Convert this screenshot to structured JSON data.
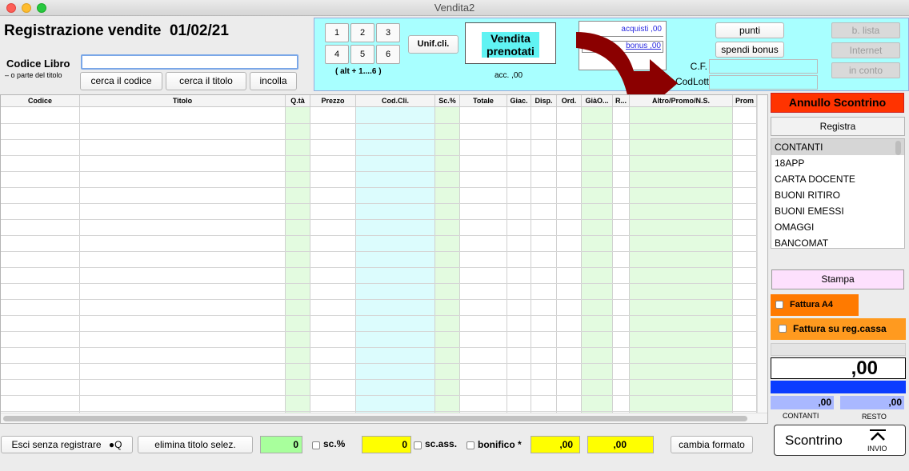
{
  "window": {
    "title": "Vendita2"
  },
  "header": {
    "title": "Registrazione vendite",
    "date": "01/02/21",
    "codice_libro_label": "Codice Libro",
    "codice_libro_hint": "– o parte del  titolo",
    "codice_libro_value": "",
    "buttons": {
      "cerca_codice": "cerca il codice",
      "cerca_titolo": "cerca il titolo",
      "incolla": "incolla"
    }
  },
  "cyan_panel": {
    "num_buttons": [
      "1",
      "2",
      "3",
      "4",
      "5",
      "6"
    ],
    "alt_hint": "( alt + 1....6 )",
    "unif_cli": "Unif.cli.",
    "vendita_prenotati": "Vendita prenotati",
    "acc": "acc. ,00",
    "acquisti": "acquisti ,00",
    "bonus": "bonus ,00",
    "punti": "punti",
    "spendi_bonus": "spendi bonus",
    "cf_label": "C.F.",
    "codlott_label": "CodLott",
    "b_lista": "b. lista",
    "internet": "Internet",
    "in_conto": "in conto"
  },
  "table": {
    "columns": [
      "Codice",
      "Titolo",
      "Q.tà",
      "Prezzo",
      "Cod.Cli.",
      "Sc.%",
      "Totale",
      "Giac.",
      "Disp.",
      "Ord.",
      "GiàO...",
      "R...",
      "Altro/Promo/N.S.",
      "Prom"
    ]
  },
  "right_panel": {
    "annullo": "Annullo Scontrino",
    "registra": "Registra",
    "payments": [
      "CONTANTI",
      "18APP",
      "CARTA DOCENTE",
      "BUONI RITIRO",
      "BUONI EMESSI",
      "OMAGGI",
      "BANCOMAT"
    ],
    "stampa": "Stampa",
    "fattura_a4": "Fattura A4",
    "fattura_reg_cassa": "Fattura su reg.cassa",
    "total": ",00",
    "contanti_value": ",00",
    "resto_value": ",00",
    "contanti_label": "CONTANTI",
    "resto_label": "RESTO",
    "scontrino": "Scontrino",
    "invio": "INVIO"
  },
  "bottom_bar": {
    "esci": "Esci senza registrare",
    "apple_q": "Q",
    "elimina": "elimina titolo selez.",
    "qty_total": "0",
    "sc_pct": "sc.%",
    "sc_ass_value": "0",
    "sc_ass": "sc.ass.",
    "bonifico": "bonifico *",
    "value1": ",00",
    "value2": ",00",
    "cambia_formato": "cambia formato"
  },
  "colors": {
    "cyan": "#a8ffff",
    "green_col": "#e3fbe0",
    "cyan_col": "#dcfcfd",
    "annullo_red": "#ff3300",
    "orange": "#ff7a00",
    "blue_bar": "#0b3cff",
    "yellow": "#ffff00",
    "arrow": "#8b0000"
  }
}
